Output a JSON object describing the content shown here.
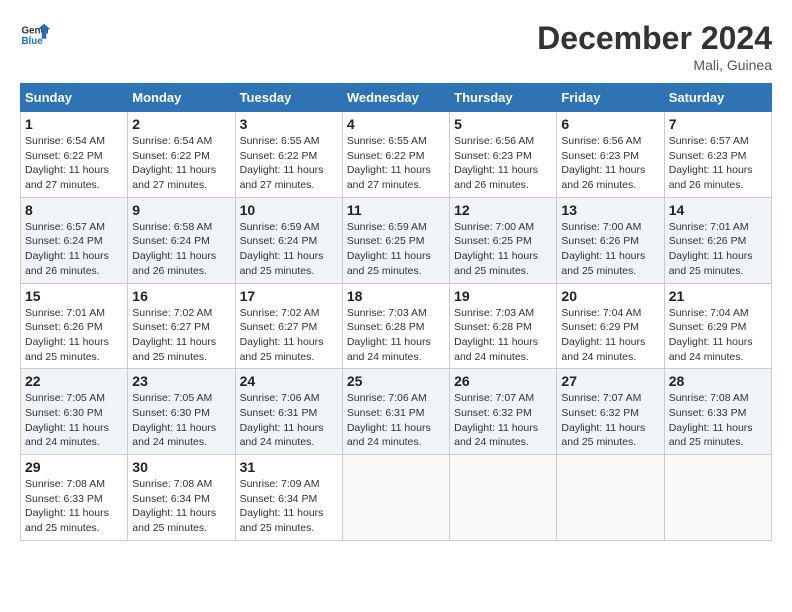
{
  "header": {
    "logo_general": "General",
    "logo_blue": "Blue",
    "month_year": "December 2024",
    "location": "Mali, Guinea"
  },
  "weekdays": [
    "Sunday",
    "Monday",
    "Tuesday",
    "Wednesday",
    "Thursday",
    "Friday",
    "Saturday"
  ],
  "weeks": [
    [
      {
        "day": "1",
        "info": "Sunrise: 6:54 AM\nSunset: 6:22 PM\nDaylight: 11 hours\nand 27 minutes."
      },
      {
        "day": "2",
        "info": "Sunrise: 6:54 AM\nSunset: 6:22 PM\nDaylight: 11 hours\nand 27 minutes."
      },
      {
        "day": "3",
        "info": "Sunrise: 6:55 AM\nSunset: 6:22 PM\nDaylight: 11 hours\nand 27 minutes."
      },
      {
        "day": "4",
        "info": "Sunrise: 6:55 AM\nSunset: 6:22 PM\nDaylight: 11 hours\nand 27 minutes."
      },
      {
        "day": "5",
        "info": "Sunrise: 6:56 AM\nSunset: 6:23 PM\nDaylight: 11 hours\nand 26 minutes."
      },
      {
        "day": "6",
        "info": "Sunrise: 6:56 AM\nSunset: 6:23 PM\nDaylight: 11 hours\nand 26 minutes."
      },
      {
        "day": "7",
        "info": "Sunrise: 6:57 AM\nSunset: 6:23 PM\nDaylight: 11 hours\nand 26 minutes."
      }
    ],
    [
      {
        "day": "8",
        "info": "Sunrise: 6:57 AM\nSunset: 6:24 PM\nDaylight: 11 hours\nand 26 minutes."
      },
      {
        "day": "9",
        "info": "Sunrise: 6:58 AM\nSunset: 6:24 PM\nDaylight: 11 hours\nand 26 minutes."
      },
      {
        "day": "10",
        "info": "Sunrise: 6:59 AM\nSunset: 6:24 PM\nDaylight: 11 hours\nand 25 minutes."
      },
      {
        "day": "11",
        "info": "Sunrise: 6:59 AM\nSunset: 6:25 PM\nDaylight: 11 hours\nand 25 minutes."
      },
      {
        "day": "12",
        "info": "Sunrise: 7:00 AM\nSunset: 6:25 PM\nDaylight: 11 hours\nand 25 minutes."
      },
      {
        "day": "13",
        "info": "Sunrise: 7:00 AM\nSunset: 6:26 PM\nDaylight: 11 hours\nand 25 minutes."
      },
      {
        "day": "14",
        "info": "Sunrise: 7:01 AM\nSunset: 6:26 PM\nDaylight: 11 hours\nand 25 minutes."
      }
    ],
    [
      {
        "day": "15",
        "info": "Sunrise: 7:01 AM\nSunset: 6:26 PM\nDaylight: 11 hours\nand 25 minutes."
      },
      {
        "day": "16",
        "info": "Sunrise: 7:02 AM\nSunset: 6:27 PM\nDaylight: 11 hours\nand 25 minutes."
      },
      {
        "day": "17",
        "info": "Sunrise: 7:02 AM\nSunset: 6:27 PM\nDaylight: 11 hours\nand 25 minutes."
      },
      {
        "day": "18",
        "info": "Sunrise: 7:03 AM\nSunset: 6:28 PM\nDaylight: 11 hours\nand 24 minutes."
      },
      {
        "day": "19",
        "info": "Sunrise: 7:03 AM\nSunset: 6:28 PM\nDaylight: 11 hours\nand 24 minutes."
      },
      {
        "day": "20",
        "info": "Sunrise: 7:04 AM\nSunset: 6:29 PM\nDaylight: 11 hours\nand 24 minutes."
      },
      {
        "day": "21",
        "info": "Sunrise: 7:04 AM\nSunset: 6:29 PM\nDaylight: 11 hours\nand 24 minutes."
      }
    ],
    [
      {
        "day": "22",
        "info": "Sunrise: 7:05 AM\nSunset: 6:30 PM\nDaylight: 11 hours\nand 24 minutes."
      },
      {
        "day": "23",
        "info": "Sunrise: 7:05 AM\nSunset: 6:30 PM\nDaylight: 11 hours\nand 24 minutes."
      },
      {
        "day": "24",
        "info": "Sunrise: 7:06 AM\nSunset: 6:31 PM\nDaylight: 11 hours\nand 24 minutes."
      },
      {
        "day": "25",
        "info": "Sunrise: 7:06 AM\nSunset: 6:31 PM\nDaylight: 11 hours\nand 24 minutes."
      },
      {
        "day": "26",
        "info": "Sunrise: 7:07 AM\nSunset: 6:32 PM\nDaylight: 11 hours\nand 24 minutes."
      },
      {
        "day": "27",
        "info": "Sunrise: 7:07 AM\nSunset: 6:32 PM\nDaylight: 11 hours\nand 25 minutes."
      },
      {
        "day": "28",
        "info": "Sunrise: 7:08 AM\nSunset: 6:33 PM\nDaylight: 11 hours\nand 25 minutes."
      }
    ],
    [
      {
        "day": "29",
        "info": "Sunrise: 7:08 AM\nSunset: 6:33 PM\nDaylight: 11 hours\nand 25 minutes."
      },
      {
        "day": "30",
        "info": "Sunrise: 7:08 AM\nSunset: 6:34 PM\nDaylight: 11 hours\nand 25 minutes."
      },
      {
        "day": "31",
        "info": "Sunrise: 7:09 AM\nSunset: 6:34 PM\nDaylight: 11 hours\nand 25 minutes."
      },
      {
        "day": "",
        "info": ""
      },
      {
        "day": "",
        "info": ""
      },
      {
        "day": "",
        "info": ""
      },
      {
        "day": "",
        "info": ""
      }
    ]
  ]
}
